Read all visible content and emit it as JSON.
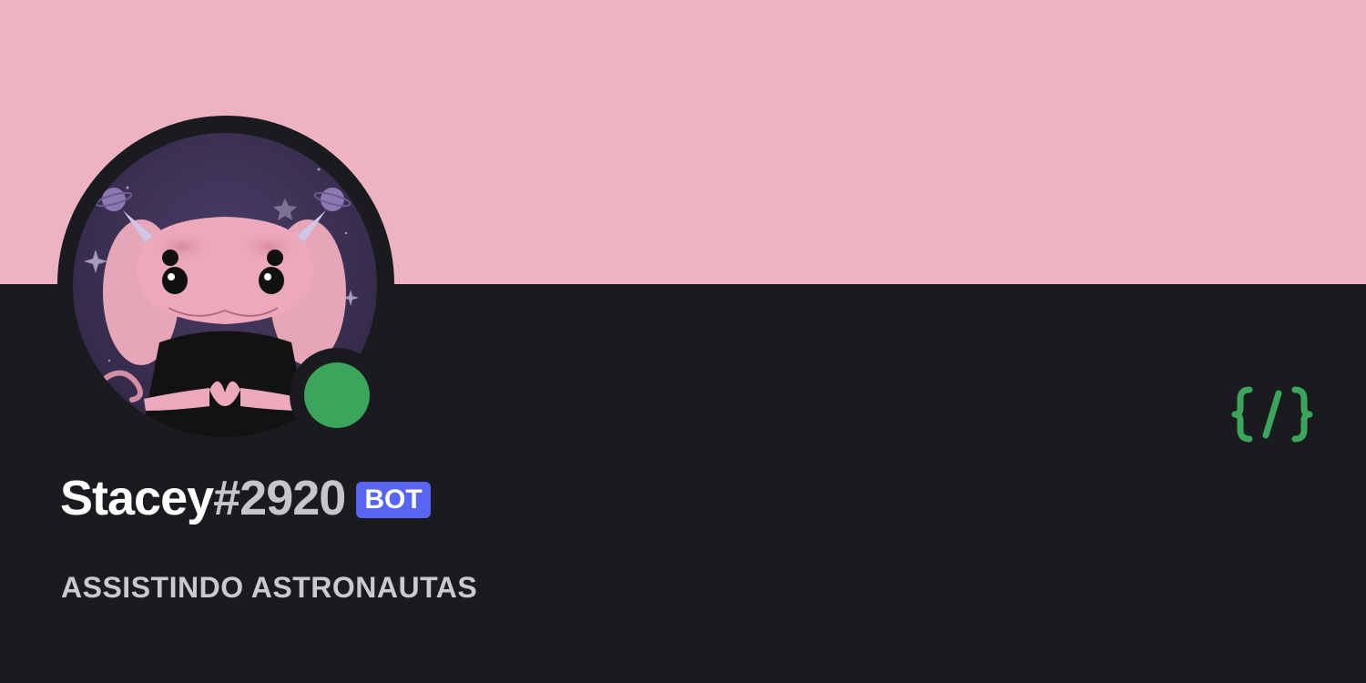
{
  "profile": {
    "username": "Stacey",
    "discriminator": "#2920",
    "bot_badge": "BOT",
    "activity": "ASSISTINDO ASTRONAUTAS",
    "status": "online",
    "avatar_icon": "pink-axolotl-astronaut-avatar",
    "developer_badge_icon": "code-braces-icon"
  },
  "colors": {
    "banner": "#edb3c1",
    "card_background": "#1a1b1f",
    "status_online": "#3ba55c",
    "bot_badge": "#5865f2",
    "developer_badge": "#3ba55c"
  }
}
